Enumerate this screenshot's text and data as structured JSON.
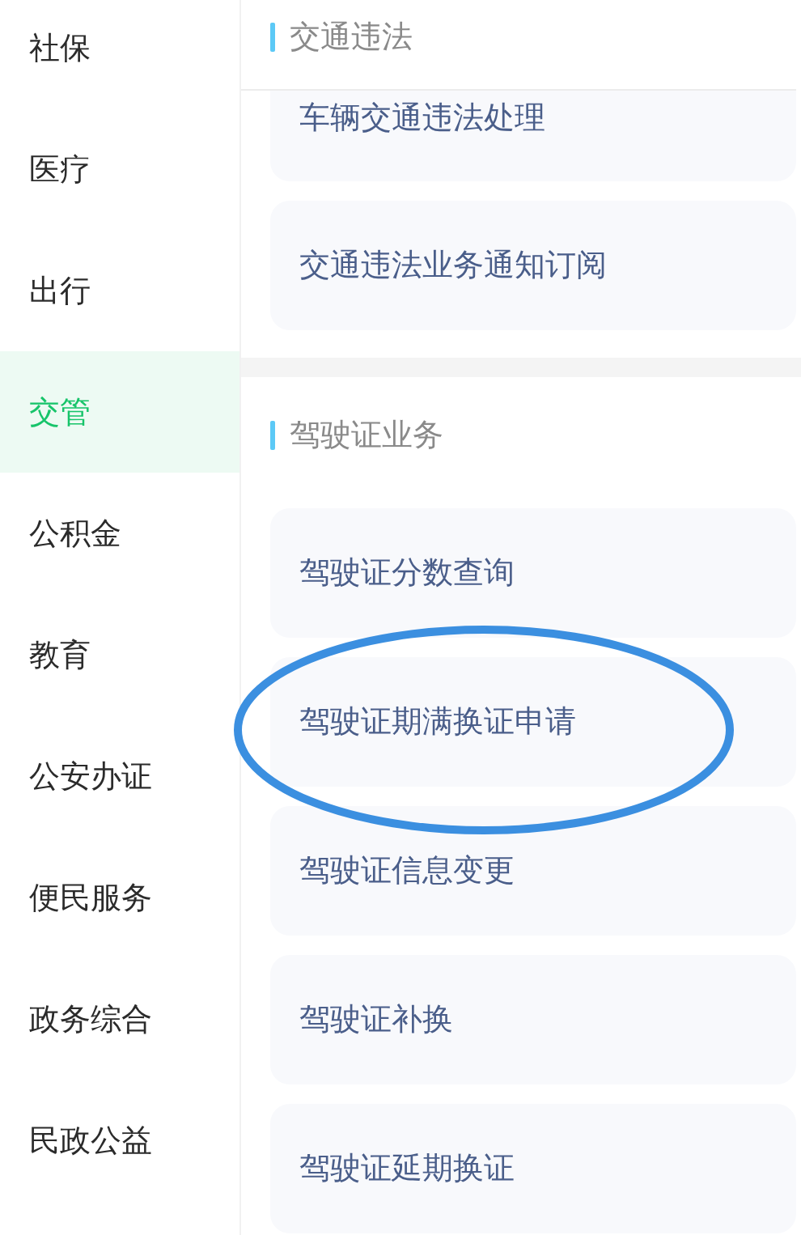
{
  "sidebar": {
    "items": [
      {
        "label": "社保",
        "selected": false
      },
      {
        "label": "医疗",
        "selected": false
      },
      {
        "label": "出行",
        "selected": false
      },
      {
        "label": "交管",
        "selected": true
      },
      {
        "label": "公积金",
        "selected": false
      },
      {
        "label": "教育",
        "selected": false
      },
      {
        "label": "公安办证",
        "selected": false
      },
      {
        "label": "便民服务",
        "selected": false
      },
      {
        "label": "政务综合",
        "selected": false
      },
      {
        "label": "民政公益",
        "selected": false
      }
    ]
  },
  "sections": [
    {
      "title": "交通违法",
      "items": [
        "车辆交通违法处理",
        "交通违法业务通知订阅"
      ]
    },
    {
      "title": "驾驶证业务",
      "items": [
        "驾驶证分数查询",
        "驾驶证期满换证申请",
        "驾驶证信息变更",
        "驾驶证补换",
        "驾驶证延期换证"
      ]
    }
  ]
}
